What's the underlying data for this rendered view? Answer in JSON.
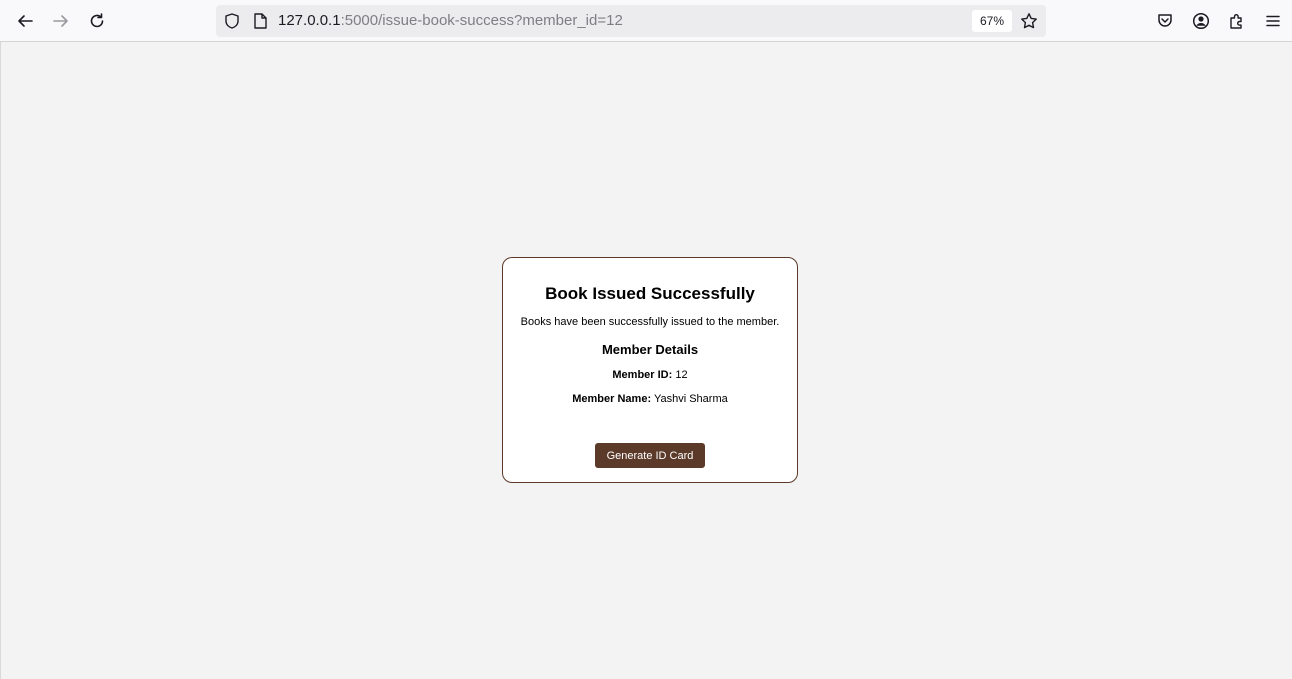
{
  "browser": {
    "url_host": "127.0.0.1",
    "url_rest": ":5000/issue-book-success?member_id=12",
    "zoom": "67%",
    "icons": [
      "back-icon",
      "forward-icon",
      "reload-icon",
      "shield-icon",
      "page-icon",
      "star-icon",
      "pocket-icon",
      "account-icon",
      "extensions-icon",
      "menu-icon"
    ]
  },
  "card": {
    "title": "Book Issued Successfully",
    "message": "Books have been successfully issued to the member.",
    "details_heading": "Member Details",
    "member_id_label": "Member ID:",
    "member_id_value": "12",
    "member_name_label": "Member Name:",
    "member_name_value": "Yashvi Sharma",
    "button_label": "Generate ID Card"
  },
  "colors": {
    "accent": "#5b3a29",
    "page_bg": "#f3f3f3"
  }
}
